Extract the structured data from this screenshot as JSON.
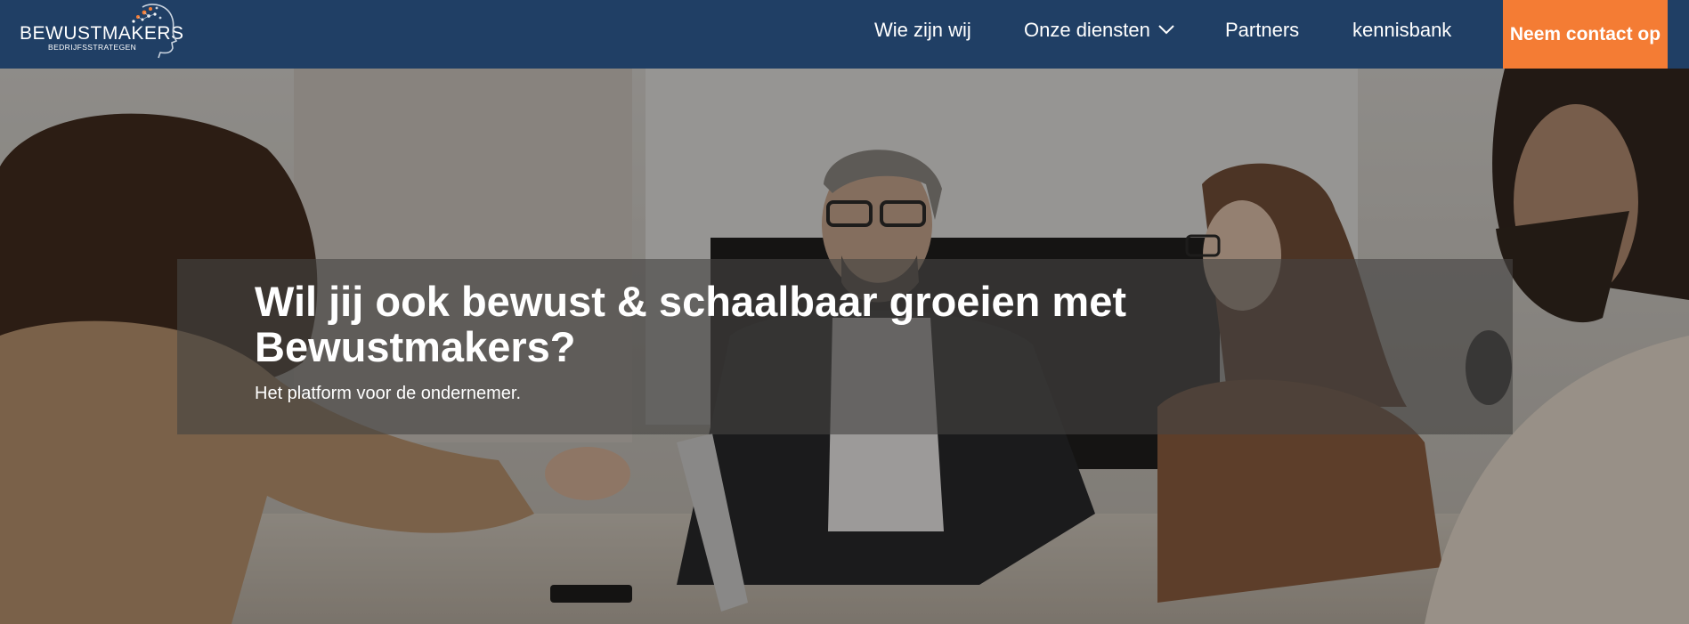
{
  "brand": {
    "name": "BEWUSTMAKERS",
    "tagline": "BEDRIJFSSTRATEGEN"
  },
  "nav": {
    "items": [
      {
        "label": "Wie zijn wij"
      },
      {
        "label": "Onze diensten",
        "icon": "chevron-down-icon"
      },
      {
        "label": "Partners"
      },
      {
        "label": "kennisbank"
      }
    ],
    "cta_label": "Neem contact op"
  },
  "hero": {
    "title": "Wil jij ook bewust & schaalbaar groeien met Bewustmakers?",
    "subtitle": "Het platform voor de ondernemer."
  },
  "colors": {
    "header_bg": "#203f65",
    "cta_bg": "#f47c34",
    "text": "#ffffff"
  }
}
